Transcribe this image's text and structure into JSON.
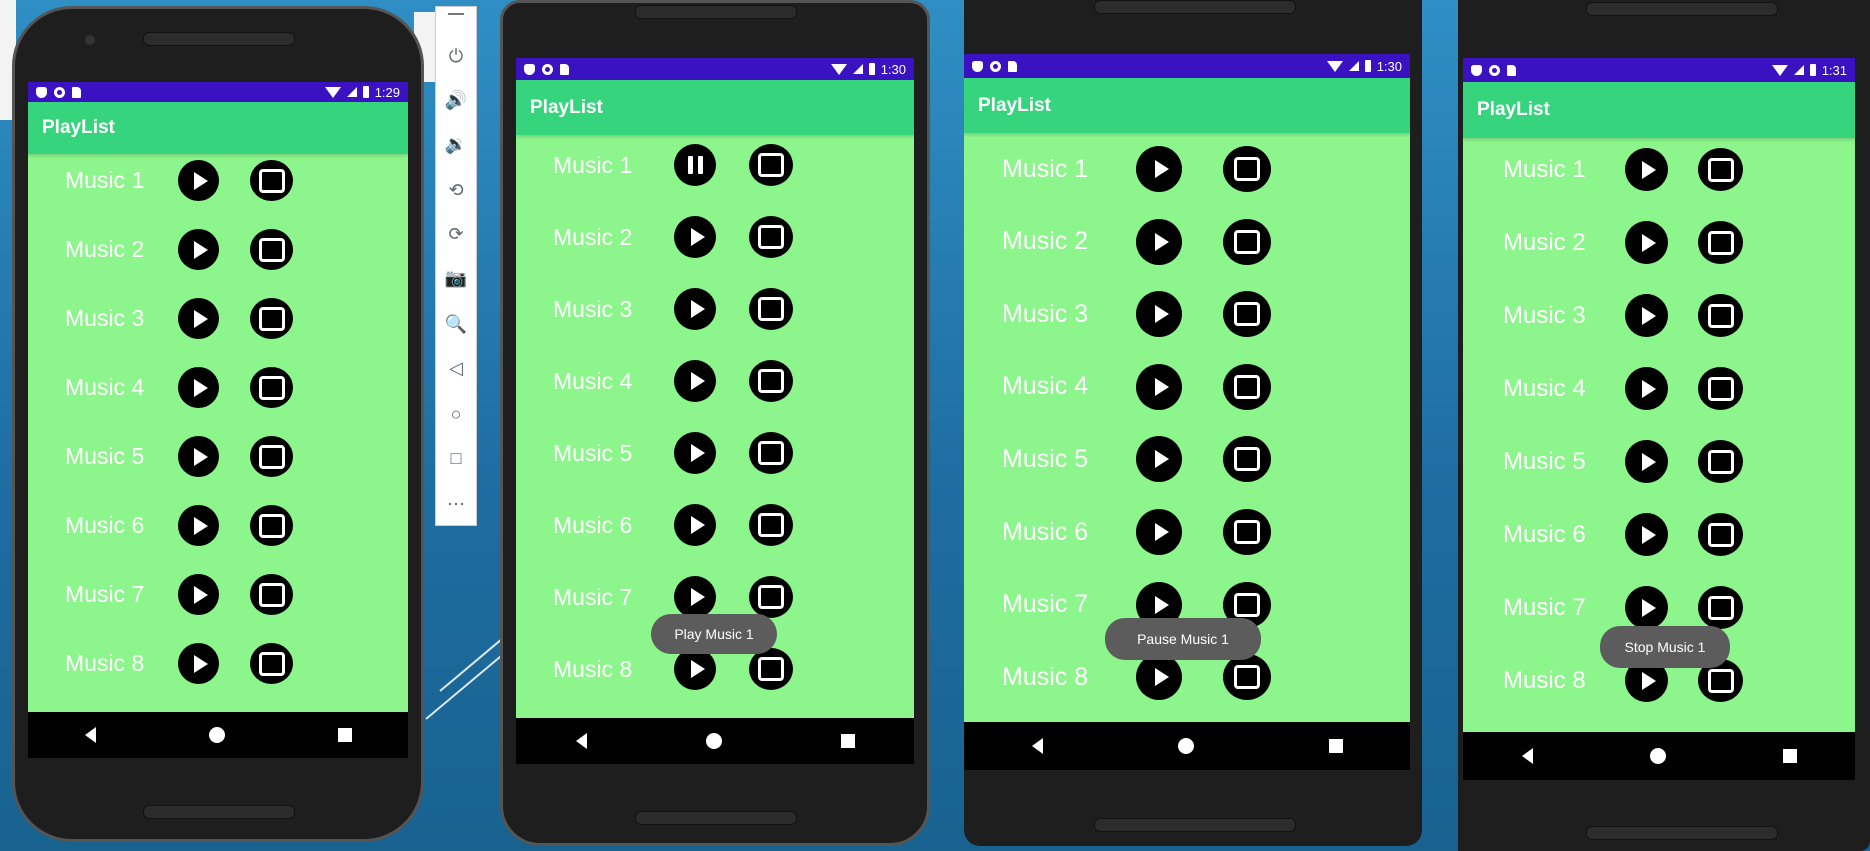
{
  "app": {
    "title": "PlayList"
  },
  "toasts": [
    "Play Music 1",
    "Pause Music 1",
    "Stop Music 1"
  ],
  "phones": [
    {
      "time": "1:29",
      "toast": "",
      "tracks": [
        {
          "label": "Music 1",
          "state": "play"
        },
        {
          "label": "Music 2",
          "state": "play"
        },
        {
          "label": "Music 3",
          "state": "play"
        },
        {
          "label": "Music 4",
          "state": "play"
        },
        {
          "label": "Music 5",
          "state": "play"
        },
        {
          "label": "Music 6",
          "state": "play"
        },
        {
          "label": "Music 7",
          "state": "play"
        },
        {
          "label": "Music 8",
          "state": "play"
        }
      ]
    },
    {
      "time": "1:30",
      "toast": "Play Music 1",
      "tracks": [
        {
          "label": "Music 1",
          "state": "pause"
        },
        {
          "label": "Music 2",
          "state": "play"
        },
        {
          "label": "Music 3",
          "state": "play"
        },
        {
          "label": "Music 4",
          "state": "play"
        },
        {
          "label": "Music 5",
          "state": "play"
        },
        {
          "label": "Music 6",
          "state": "play"
        },
        {
          "label": "Music 7",
          "state": "play"
        },
        {
          "label": "Music 8",
          "state": "play"
        }
      ]
    },
    {
      "time": "1:30",
      "toast": "Pause Music 1",
      "tracks": [
        {
          "label": "Music 1",
          "state": "play"
        },
        {
          "label": "Music 2",
          "state": "play"
        },
        {
          "label": "Music 3",
          "state": "play"
        },
        {
          "label": "Music 4",
          "state": "play"
        },
        {
          "label": "Music 5",
          "state": "play"
        },
        {
          "label": "Music 6",
          "state": "play"
        },
        {
          "label": "Music 7",
          "state": "play"
        },
        {
          "label": "Music 8",
          "state": "play"
        }
      ]
    },
    {
      "time": "1:31",
      "toast": "Stop Music 1",
      "tracks": [
        {
          "label": "Music 1",
          "state": "play"
        },
        {
          "label": "Music 2",
          "state": "play"
        },
        {
          "label": "Music 3",
          "state": "play"
        },
        {
          "label": "Music 4",
          "state": "play"
        },
        {
          "label": "Music 5",
          "state": "play"
        },
        {
          "label": "Music 6",
          "state": "play"
        },
        {
          "label": "Music 7",
          "state": "play"
        },
        {
          "label": "Music 8",
          "state": "play"
        }
      ]
    }
  ],
  "emulator_toolbar": [
    "power-icon",
    "volume-up-icon",
    "volume-down-icon",
    "rotate-left-icon",
    "rotate-right-icon",
    "camera-icon",
    "zoom-icon",
    "back-icon",
    "home-icon",
    "overview-icon",
    "more-icon"
  ],
  "colors": {
    "screen_bg": "#8cf58c",
    "app_bar": "#37d47e",
    "status_bar": "#3a12c2",
    "toast_bg": "#5c5c5c"
  }
}
